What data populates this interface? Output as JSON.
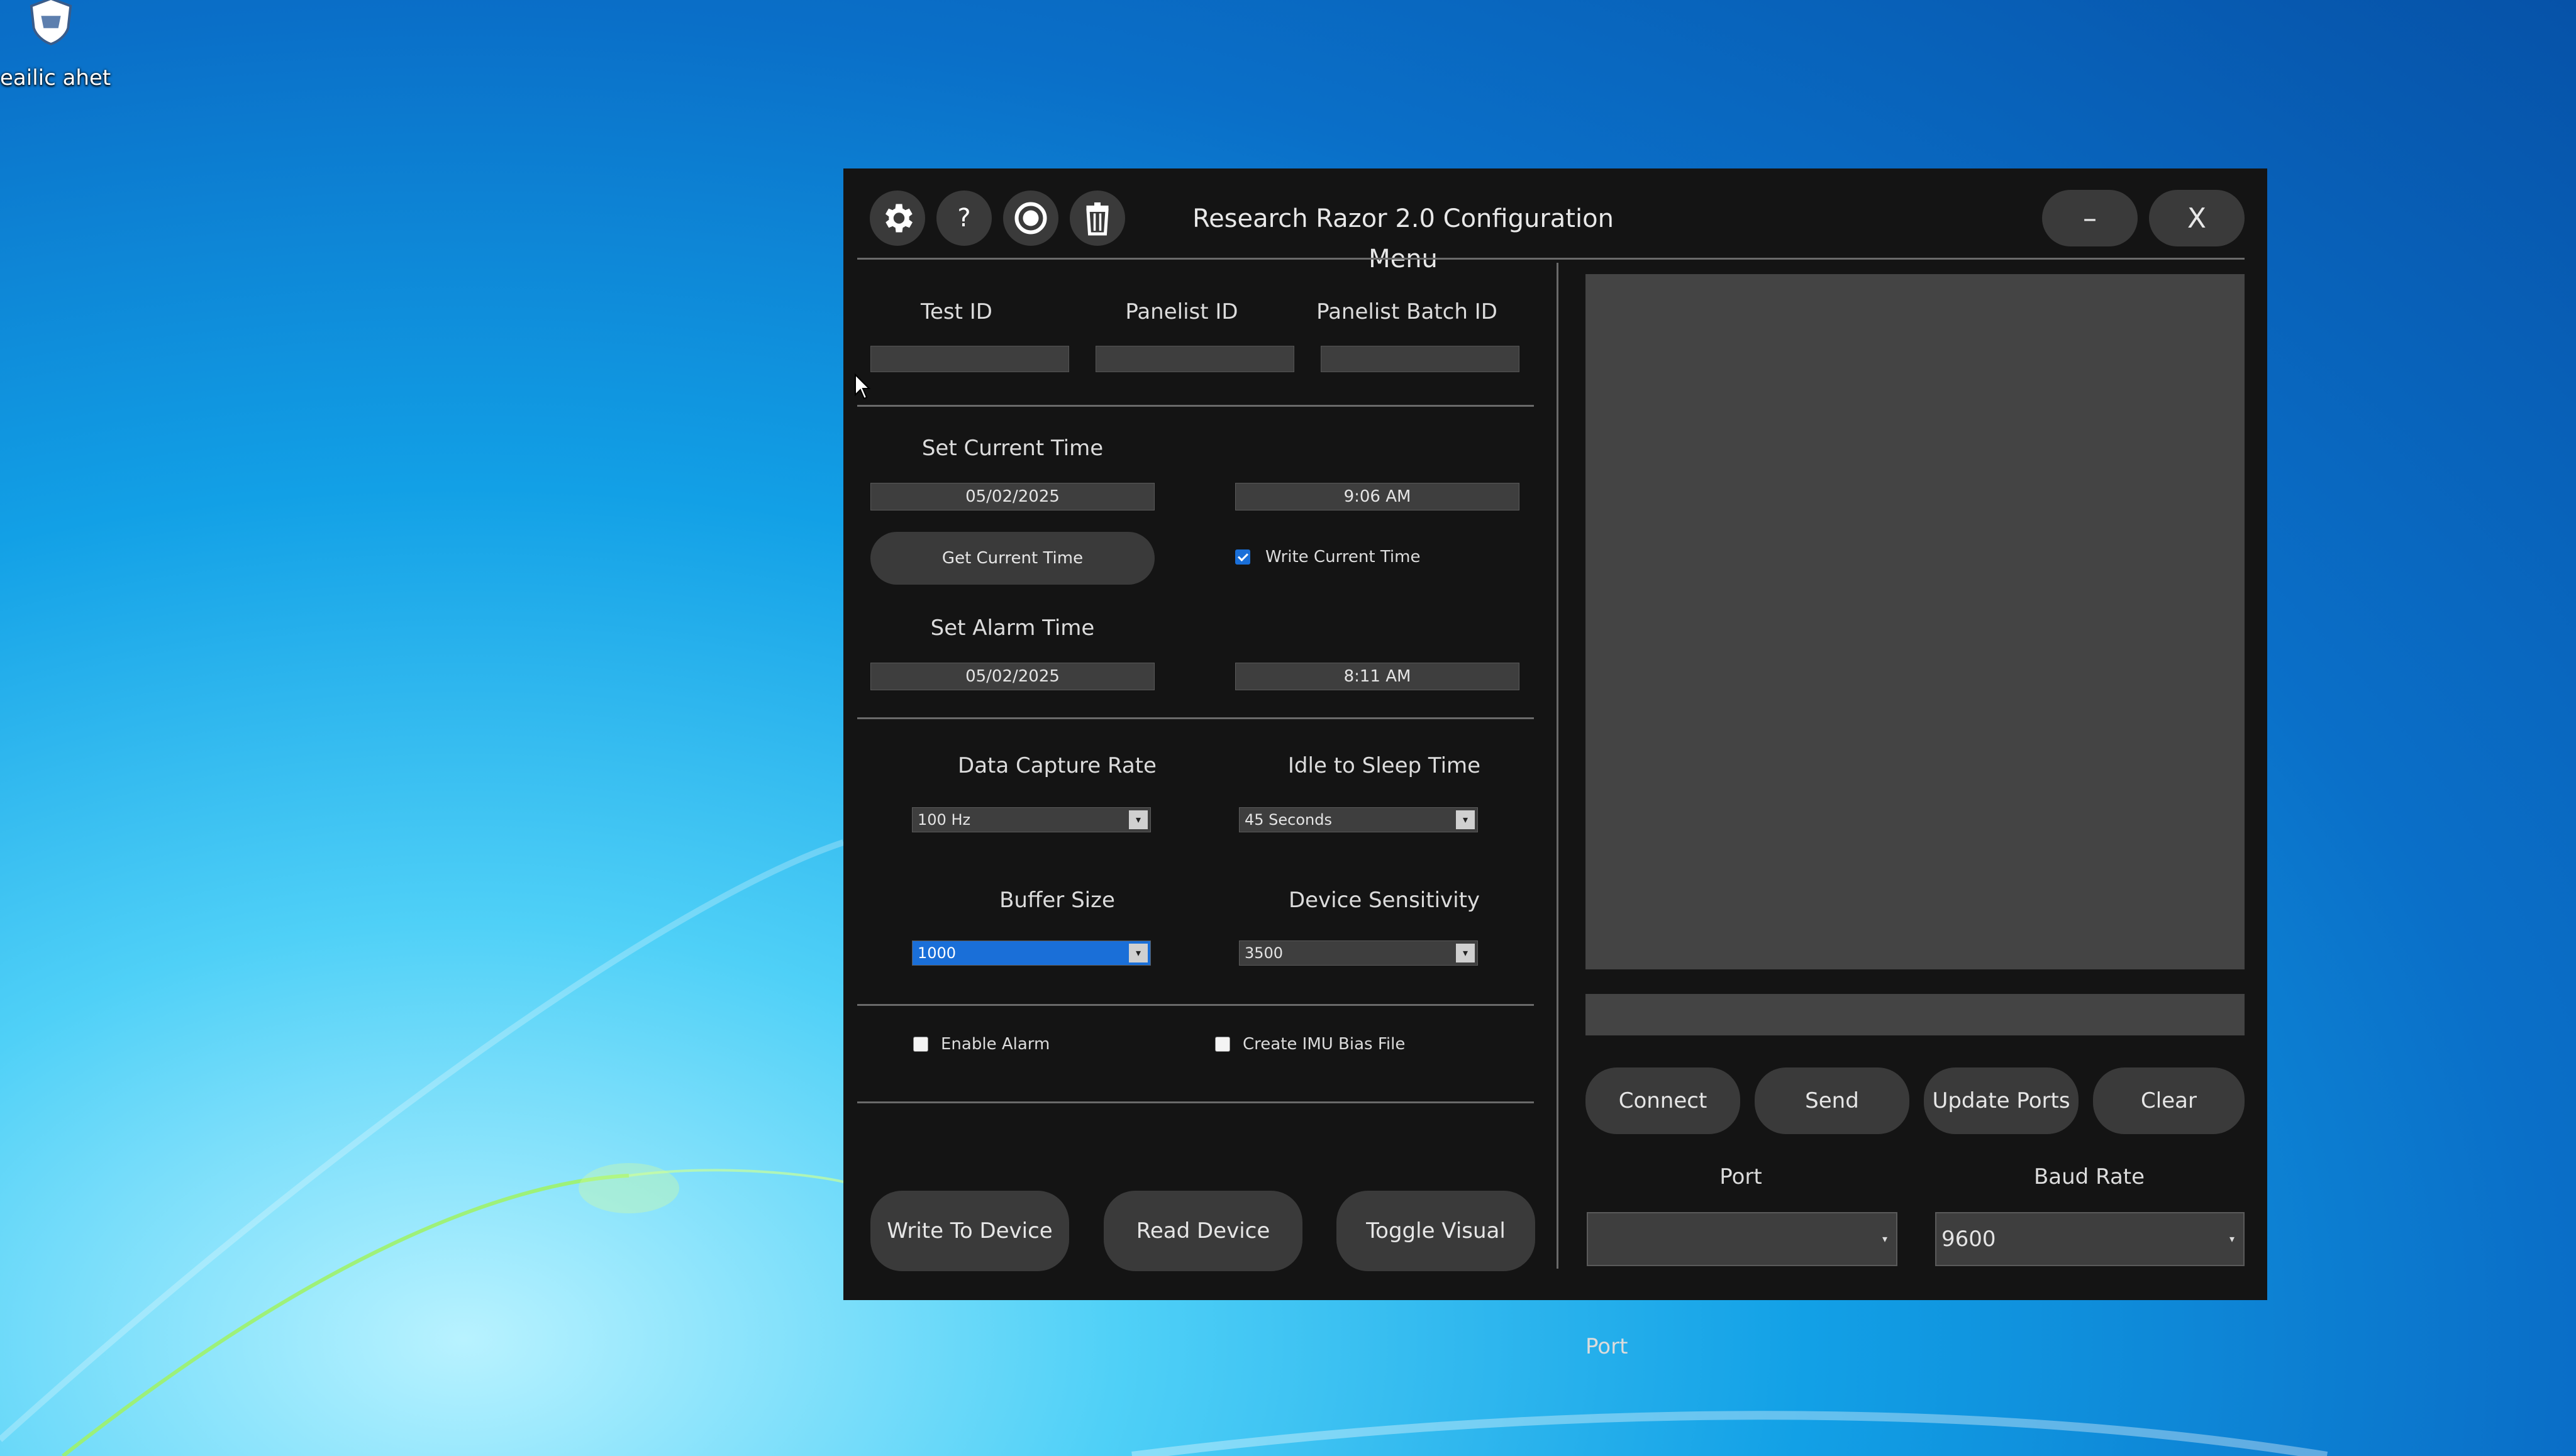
{
  "desktop": {
    "icon_label": "eailic ahet"
  },
  "window": {
    "title": "Research Razor 2.0 Configuration Menu",
    "minimize_label": "–",
    "close_label": "X",
    "help_glyph": "?"
  },
  "ids": {
    "test_id_label": "Test ID",
    "panelist_id_label": "Panelist ID",
    "panelist_batch_id_label": "Panelist Batch ID",
    "test_id_value": "",
    "panelist_id_value": "",
    "panelist_batch_id_value": ""
  },
  "current_time": {
    "heading": "Set Current Time",
    "date": "05/02/2025",
    "time": "9:06 AM",
    "get_button": "Get Current Time",
    "write_label": "Write Current Time",
    "write_checked": true
  },
  "alarm_time": {
    "heading": "Set Alarm Time",
    "date": "05/02/2025",
    "time": "8:11 AM"
  },
  "settings": {
    "capture_rate_label": "Data Capture Rate",
    "capture_rate_value": "100 Hz",
    "idle_sleep_label": "Idle to Sleep Time",
    "idle_sleep_value": "45 Seconds",
    "buffer_size_label": "Buffer Size",
    "buffer_size_value": "1000",
    "sensitivity_label": "Device Sensitivity",
    "sensitivity_value": "3500"
  },
  "options": {
    "enable_alarm_label": "Enable Alarm",
    "enable_alarm_checked": false,
    "imu_bias_label": "Create IMU Bias File",
    "imu_bias_checked": false
  },
  "actions": {
    "write_device": "Write To Device",
    "read_device": "Read Device",
    "toggle_visual": "Toggle Visual"
  },
  "serial": {
    "connect": "Connect",
    "send": "Send",
    "update_ports": "Update Ports",
    "clear": "Clear",
    "port_label": "Port",
    "port_value": "",
    "baud_label": "Baud Rate",
    "baud_value": "9600"
  },
  "colors": {
    "accent": "#1a6fd8",
    "window_bg": "#141414",
    "panel_gray": "#444444"
  }
}
